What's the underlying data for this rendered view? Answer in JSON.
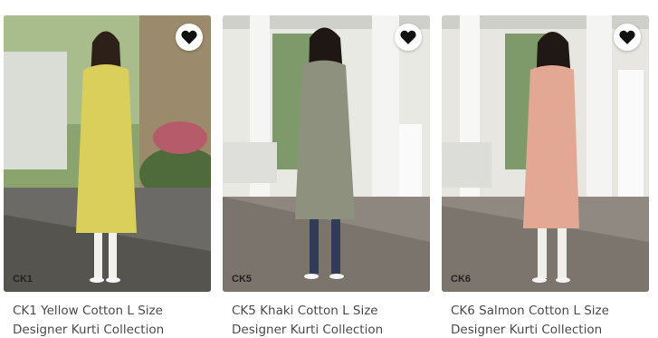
{
  "products": [
    {
      "code": "CK1",
      "title": "CK1 Yellow Cotton L Size Designer Kurti Collection",
      "kurti_color": "#d9cf5a",
      "bottom_color": "#f3f1ec",
      "bg_color": "#6f8a55",
      "icon": "heart-icon"
    },
    {
      "code": "CK5",
      "title": "CK5 Khaki Cotton L Size Designer Kurti Collection",
      "kurti_color": "#8f917f",
      "bottom_color": "#2f3b57",
      "bg_color": "#e9e9e4",
      "icon": "heart-icon"
    },
    {
      "code": "CK6",
      "title": "CK6 Salmon Cotton L Size Designer Kurti Collection",
      "kurti_color": "#e3a893",
      "bottom_color": "#f1efe9",
      "bg_color": "#e7e6e1",
      "icon": "heart-icon"
    }
  ]
}
